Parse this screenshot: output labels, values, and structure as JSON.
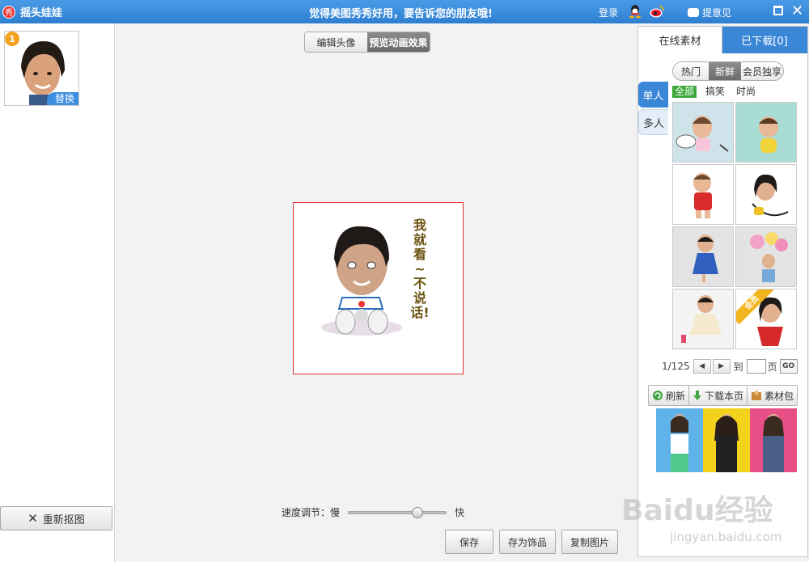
{
  "titlebar": {
    "logo_char": "秀",
    "app_title": "摇头娃娃",
    "slogan": "觉得美图秀秀好用，要告诉您的朋友哦!",
    "login": "登录",
    "feedback": "提意见"
  },
  "left": {
    "thumb_badge": "1",
    "replace_label": "替换",
    "reselect_label": "重新抠图"
  },
  "center": {
    "tabs": [
      {
        "label": "编辑头像",
        "active": false
      },
      {
        "label": "预览动画效果",
        "active": true
      }
    ],
    "preview_caption": "我就看~不说话!",
    "speed": {
      "label": "速度调节：",
      "slow": "慢",
      "fast": "快",
      "level": 0.72
    },
    "buttons": {
      "save": "保存",
      "save_as_accessory": "存为饰品",
      "copy_image": "复制图片"
    }
  },
  "right": {
    "tabs": [
      {
        "label": "在线素材",
        "active": true
      },
      {
        "label": "已下载[0]",
        "active": false
      }
    ],
    "filters": [
      {
        "label": "热门",
        "active": false
      },
      {
        "label": "新鲜",
        "active": true
      },
      {
        "label": "会员独享",
        "active": false
      }
    ],
    "side_tabs": [
      {
        "label": "单人",
        "active": true
      },
      {
        "label": "多人",
        "active": false
      }
    ],
    "categories": [
      {
        "label": "全部",
        "active": true
      },
      {
        "label": "搞笑",
        "active": false
      },
      {
        "label": "时尚",
        "active": false
      }
    ],
    "member_badge": "会员",
    "pager": {
      "current": "1/125",
      "goto_prefix": "到",
      "page_suffix": "页",
      "go": "GO"
    },
    "actions": {
      "refresh": "刷新",
      "download_page": "下载本页",
      "material_pack": "素材包"
    }
  },
  "watermark": {
    "brand": "Bai",
    "brand2": "du",
    "brand_cn": "经验",
    "url": "jingyan.baidu.com"
  }
}
